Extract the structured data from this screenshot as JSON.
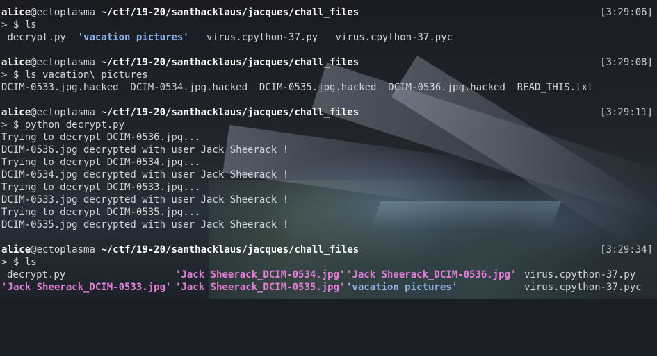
{
  "prompt": {
    "user": "alice",
    "host": "@ectoplasma",
    "path": "~/ctf/19-20/santhacklaus/jacques/chall_files",
    "symbol": "> $"
  },
  "blocks": [
    {
      "time": "[3:29:06]",
      "command": "ls",
      "output_parts": [
        {
          "text": "decrypt.py",
          "type": "file"
        },
        {
          "text": "'vacation pictures'",
          "type": "dir"
        },
        {
          "text": "virus.cpython-37.py",
          "type": "file"
        },
        {
          "text": "virus.cpython-37.pyc",
          "type": "file"
        }
      ]
    },
    {
      "time": "[3:29:08]",
      "command": "ls vacation\\ pictures",
      "output_line": "DCIM-0533.jpg.hacked  DCIM-0534.jpg.hacked  DCIM-0535.jpg.hacked  DCIM-0536.jpg.hacked  READ_THIS.txt"
    },
    {
      "time": "[3:29:11]",
      "command": "python decrypt.py",
      "output_lines": [
        "Trying to decrypt DCIM-0536.jpg...",
        "DCIM-0536.jpg decrypted with user Jack Sheerack !",
        "Trying to decrypt DCIM-0534.jpg...",
        "DCIM-0534.jpg decrypted with user Jack Sheerack !",
        "Trying to decrypt DCIM-0533.jpg...",
        "DCIM-0533.jpg decrypted with user Jack Sheerack !",
        "Trying to decrypt DCIM-0535.jpg...",
        "DCIM-0535.jpg decrypted with user Jack Sheerack !"
      ]
    },
    {
      "time": "[3:29:34]",
      "command": "ls",
      "grid": [
        [
          {
            "text": "decrypt.py",
            "type": "file"
          },
          {
            "text": "'Jack Sheerack_DCIM-0534.jpg'",
            "type": "img"
          },
          {
            "text": "'Jack Sheerack_DCIM-0536.jpg'",
            "type": "img"
          },
          {
            "text": "virus.cpython-37.py",
            "type": "file"
          }
        ],
        [
          {
            "text": "'Jack Sheerack_DCIM-0533.jpg'",
            "type": "img"
          },
          {
            "text": "'Jack Sheerack_DCIM-0535.jpg'",
            "type": "img"
          },
          {
            "text": "'vacation pictures'",
            "type": "dir"
          },
          {
            "text": "virus.cpython-37.pyc",
            "type": "file"
          }
        ]
      ]
    }
  ],
  "colors": {
    "dir": "#8fb4e8",
    "image": "#e37fd8",
    "text": "#d4d7dc"
  }
}
